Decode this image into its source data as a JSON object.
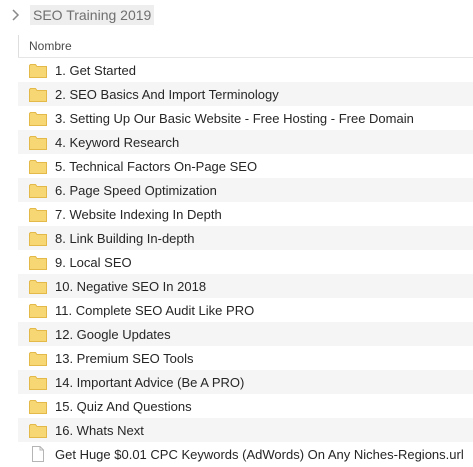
{
  "breadcrumb": {
    "current": "SEO Training 2019"
  },
  "column": {
    "name": "Nombre"
  },
  "items": [
    {
      "label": "1. Get Started",
      "icon": "folder-icon"
    },
    {
      "label": "2. SEO Basics And Import Terminology",
      "icon": "folder-icon"
    },
    {
      "label": "3. Setting Up Our Basic Website - Free Hosting - Free Domain",
      "icon": "folder-icon"
    },
    {
      "label": "4. Keyword Research",
      "icon": "folder-icon"
    },
    {
      "label": "5. Technical Factors On-Page SEO",
      "icon": "folder-icon"
    },
    {
      "label": "6. Page Speed Optimization",
      "icon": "folder-icon"
    },
    {
      "label": "7. Website Indexing In Depth",
      "icon": "folder-icon"
    },
    {
      "label": "8. Link Building In-depth",
      "icon": "folder-icon"
    },
    {
      "label": "9. Local SEO",
      "icon": "folder-icon"
    },
    {
      "label": "10. Negative SEO In 2018",
      "icon": "folder-icon"
    },
    {
      "label": "11. Complete SEO Audit Like PRO",
      "icon": "folder-icon"
    },
    {
      "label": "12. Google Updates",
      "icon": "folder-icon"
    },
    {
      "label": "13. Premium SEO Tools",
      "icon": "folder-icon"
    },
    {
      "label": "14. Important Advice (Be A PRO)",
      "icon": "folder-icon"
    },
    {
      "label": "15. Quiz And Questions",
      "icon": "folder-icon"
    },
    {
      "label": "16. Whats Next",
      "icon": "folder-icon"
    },
    {
      "label": "Get Huge $0.01 CPC Keywords (AdWords) On Any Niches-Regions.url",
      "icon": "file-icon"
    }
  ],
  "colors": {
    "folder": "#f7d774",
    "folder_edge": "#e3b94a",
    "row_alt": "#f5f5f5"
  }
}
